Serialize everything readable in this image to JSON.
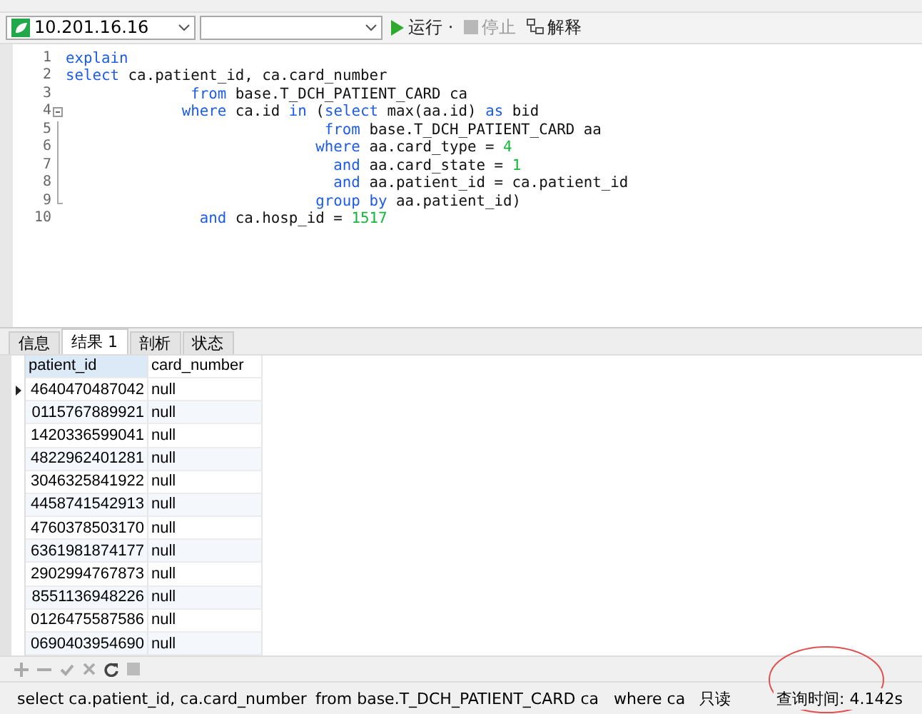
{
  "toolbar": {
    "connection": "10.201.16.16",
    "buttons": [
      {
        "kind": "run",
        "label": "运行 ·",
        "disabled": false
      },
      {
        "kind": "stop",
        "label": "停止",
        "disabled": true
      },
      {
        "kind": "explain",
        "label": "解释",
        "disabled": false
      }
    ]
  },
  "editor": {
    "lines": [
      {
        "number": "1",
        "tokens": [
          {
            "kind": "keyword",
            "text": "explain"
          }
        ]
      },
      {
        "number": "2",
        "tokens": [
          {
            "kind": "keyword",
            "text": "select"
          },
          {
            "kind": "plain",
            "text": " ca.patient_id, ca.card_number"
          }
        ]
      },
      {
        "number": "3",
        "tokens": [
          {
            "kind": "keyword",
            "text": "              from"
          },
          {
            "kind": "plain",
            "text": " base.T_DCH_PATIENT_CARD ca"
          }
        ]
      },
      {
        "number": "4",
        "kind": "fold-start",
        "tokens": [
          {
            "kind": "keyword",
            "text": "             where"
          },
          {
            "kind": "plain",
            "text": " ca.id "
          },
          {
            "kind": "keyword",
            "text": "in"
          },
          {
            "kind": "plain",
            "text": " ("
          },
          {
            "kind": "keyword",
            "text": "select"
          },
          {
            "kind": "plain",
            "text": " max(aa.id) "
          },
          {
            "kind": "keyword",
            "text": "as"
          },
          {
            "kind": "plain",
            "text": " bid"
          }
        ]
      },
      {
        "number": "5",
        "kind": "fold-line",
        "tokens": [
          {
            "kind": "keyword",
            "text": "                             from"
          },
          {
            "kind": "plain",
            "text": " base.T_DCH_PATIENT_CARD aa"
          }
        ]
      },
      {
        "number": "6",
        "kind": "fold-line",
        "tokens": [
          {
            "kind": "keyword",
            "text": "                            where"
          },
          {
            "kind": "plain",
            "text": " aa.card_type = "
          },
          {
            "kind": "number",
            "text": "4"
          }
        ]
      },
      {
        "number": "7",
        "kind": "fold-line",
        "tokens": [
          {
            "kind": "keyword",
            "text": "                              and"
          },
          {
            "kind": "plain",
            "text": " aa.card_state = "
          },
          {
            "kind": "number",
            "text": "1"
          }
        ]
      },
      {
        "number": "8",
        "kind": "fold-line",
        "tokens": [
          {
            "kind": "keyword",
            "text": "                              and"
          },
          {
            "kind": "plain",
            "text": " aa.patient_id = ca.patient_id"
          }
        ]
      },
      {
        "number": "9",
        "kind": "fold-end",
        "tokens": [
          {
            "kind": "keyword",
            "text": "                            group by"
          },
          {
            "kind": "plain",
            "text": " aa.patient_id)"
          }
        ]
      },
      {
        "number": "10",
        "tokens": [
          {
            "kind": "keyword",
            "text": "               and"
          },
          {
            "kind": "plain",
            "text": " ca.hosp_id = "
          },
          {
            "kind": "number",
            "text": "1517"
          }
        ]
      }
    ]
  },
  "tabs": [
    {
      "label": "信息",
      "selected": false
    },
    {
      "label": "结果 1",
      "selected": true
    },
    {
      "label": "剖析",
      "selected": false
    },
    {
      "label": "状态",
      "selected": false
    }
  ],
  "table": {
    "columns": [
      "patient_id",
      "card_number"
    ],
    "rows": [
      {
        "cells": [
          "4640470487042",
          "null"
        ],
        "current": true
      },
      {
        "cells": [
          "0115767889921",
          "null"
        ],
        "current": false
      },
      {
        "cells": [
          "1420336599041",
          "null"
        ],
        "current": false
      },
      {
        "cells": [
          "4822962401281",
          "null"
        ],
        "current": false
      },
      {
        "cells": [
          "3046325841922",
          "null"
        ],
        "current": false
      },
      {
        "cells": [
          "4458741542913",
          "null"
        ],
        "current": false
      },
      {
        "cells": [
          "4760378503170",
          "null"
        ],
        "current": false
      },
      {
        "cells": [
          "6361981874177",
          "null"
        ],
        "current": false
      },
      {
        "cells": [
          "2902994767873",
          "null"
        ],
        "current": false
      },
      {
        "cells": [
          "8551136948226",
          "null"
        ],
        "current": false
      },
      {
        "cells": [
          "0126475587586",
          "null"
        ],
        "current": false
      },
      {
        "cells": [
          "0690403954690",
          "null"
        ],
        "current": false
      }
    ]
  },
  "status_bar": {
    "sql_parts": [
      "select ca.patient_id, ca.card_number",
      "from base.T_DCH_PATIENT_CARD ca",
      "where ca"
    ],
    "mode": "只读",
    "query_time": "查询时间: 4.142s",
    "circled": true
  }
}
